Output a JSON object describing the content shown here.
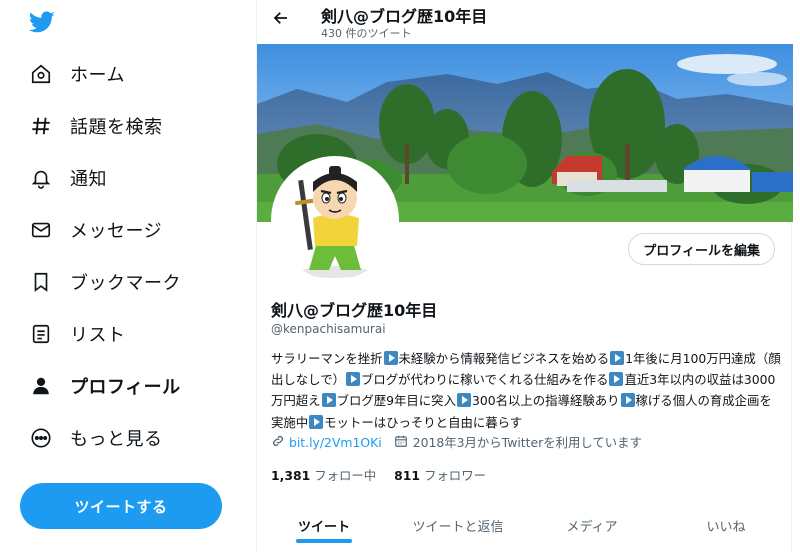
{
  "nav": {
    "home": "ホーム",
    "explore": "話題を検索",
    "notifications": "通知",
    "messages": "メッセージ",
    "bookmarks": "ブックマーク",
    "lists": "リスト",
    "profile": "プロフィール",
    "more": "もっと見る",
    "tweet_button": "ツイートする"
  },
  "header": {
    "title": "剣八@ブログ歴10年目",
    "tweet_count": "430 件のツイート"
  },
  "profile": {
    "edit_button": "プロフィールを編集",
    "name": "剣八@ブログ歴10年目",
    "handle": "@kenpachisamurai",
    "bio": [
      "サラリーマンを挫折",
      "未経験から情報発信ビジネスを始める",
      "1年後に月100万円達成（顔出しなしで）",
      "ブログが代わりに稼いでくれる仕組みを作る",
      "直近3年以内の収益は3000万円超え",
      "ブログ歴9年目に突入",
      "300名以上の指導経験あり",
      "稼げる個人の育成企画を実施中",
      "モットーはひっそりと自由に暮らす"
    ],
    "link": "bit.ly/2Vm1OKi",
    "joined": "2018年3月からTwitterを利用しています",
    "following_count": "1,381",
    "following_label": "フォロー中",
    "followers_count": "811",
    "followers_label": "フォロワー"
  },
  "tabs": [
    "ツイート",
    "ツイートと返信",
    "メディア",
    "いいね"
  ],
  "colors": {
    "accent": "#1d9bf0",
    "text": "#0f1419",
    "muted": "#536471",
    "play_emoji": "#3b88c3"
  }
}
